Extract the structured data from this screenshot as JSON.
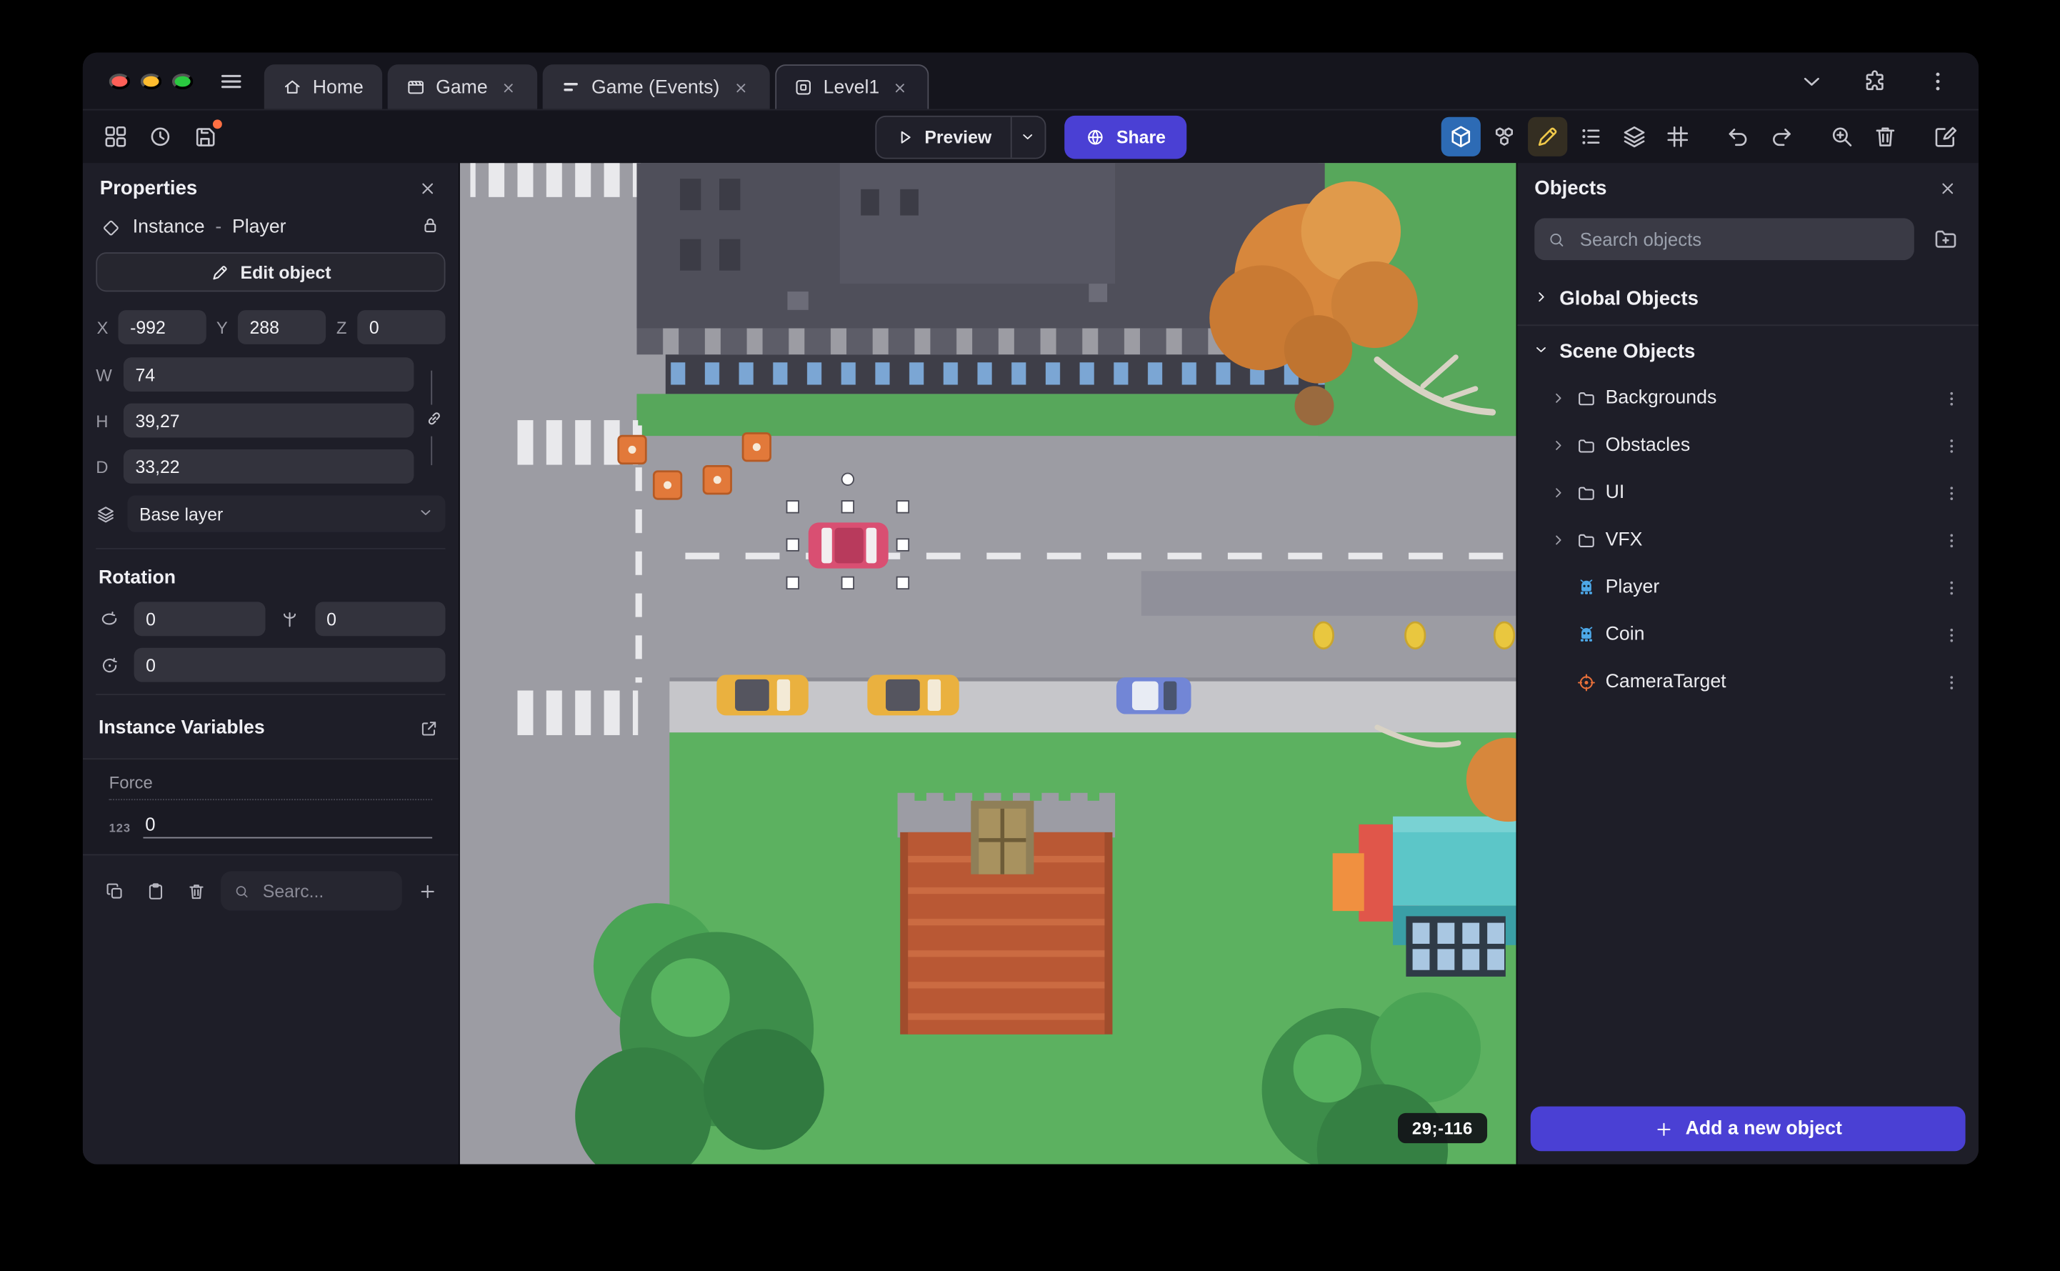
{
  "titlebar": {
    "tabs": [
      {
        "label": "Home"
      },
      {
        "label": "Game"
      },
      {
        "label": "Game (Events)"
      },
      {
        "label": "Level1"
      }
    ]
  },
  "toolbar": {
    "preview": "Preview",
    "share": "Share"
  },
  "properties": {
    "title": "Properties",
    "instance_label": "Instance",
    "dash": "-",
    "instance_name": "Player",
    "edit_object": "Edit object",
    "x_label": "X",
    "x": "-992",
    "y_label": "Y",
    "y": "288",
    "z_label": "Z",
    "z": "0",
    "w_label": "W",
    "w": "74",
    "h_label": "H",
    "h": "39,27",
    "d_label": "D",
    "d": "33,22",
    "layer": "Base layer",
    "rotation_title": "Rotation",
    "rot_x": "0",
    "rot_y": "0",
    "rot_z": "0",
    "variables_title": "Instance Variables",
    "variable_name": "Force",
    "variable_type": "123",
    "variable_value": "0",
    "search_placeholder": "Searc..."
  },
  "canvas": {
    "coords_badge": "29;-116"
  },
  "objects": {
    "title": "Objects",
    "search_placeholder": "Search objects",
    "global_group": "Global Objects",
    "scene_group": "Scene Objects",
    "folders": [
      {
        "label": "Backgrounds"
      },
      {
        "label": "Obstacles"
      },
      {
        "label": "UI"
      },
      {
        "label": "VFX"
      }
    ],
    "items": [
      {
        "label": "Player"
      },
      {
        "label": "Coin"
      },
      {
        "label": "CameraTarget"
      }
    ],
    "add_button": "Add a new object"
  },
  "icons": {
    "traffic_lights": "close / minimize / zoom circles",
    "hamburger": "menu bars",
    "home": "house outline",
    "game_tab": "clapperboard",
    "events_tab": "list lines",
    "scene_tab": "rounded square",
    "preview": "play triangle",
    "share": "globe",
    "view_3d": "cube (selected, blue)",
    "objects_tool": "three cubes",
    "edit_tool": "pencil (selected, yellow)",
    "instances_list": "dotted list",
    "layers": "stacked layers",
    "grid": "grid hash",
    "undo": "curved arrow left",
    "redo": "curved arrow right",
    "zoom": "magnifier plus",
    "trash": "trash bin",
    "scene_editor": "pencil on panel",
    "sprite": "blue creature sprite",
    "camera_target": "orange crosshair target",
    "search": "magnifier",
    "new_folder": "folder with plus",
    "kebab": "vertical three dots"
  },
  "colors": {
    "accent_purple": "#4a40d4",
    "selected_tool_blue": "#2d6bb5",
    "selected_tool_yellow": "#f0c94a",
    "unsaved_badge_orange": "#ff7043",
    "selection_pink_car": "#d94f72",
    "panel_bg": "#1e1e28",
    "titlebar_bg": "#15151d"
  }
}
